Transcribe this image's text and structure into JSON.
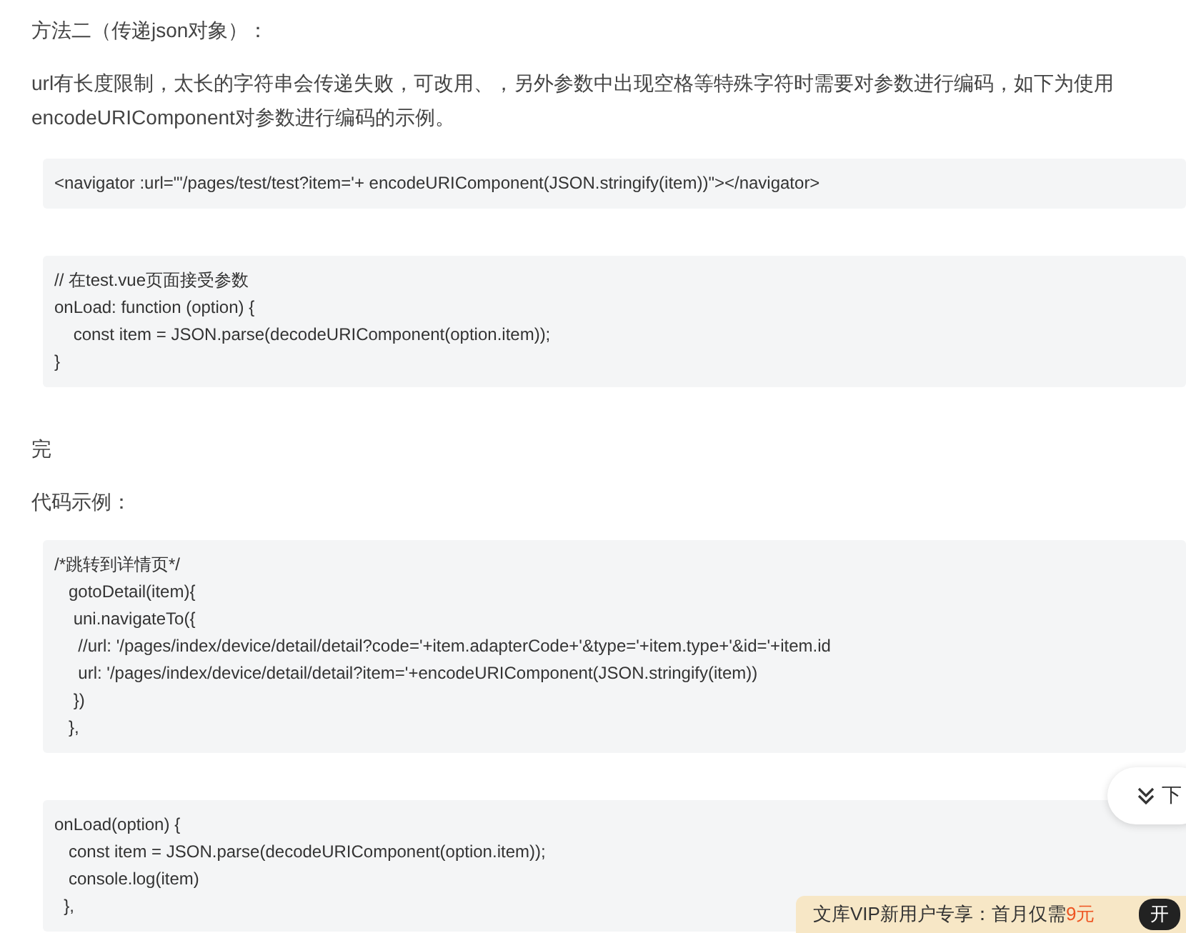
{
  "heading": "方法二（传递json对象）：",
  "paragraph": "url有长度限制，太长的字符串会传递失败，可改用、，另外参数中出现空格等特殊字符时需要对参数进行编码，如下为使用encodeURIComponent对参数进行编码的示例。",
  "code_blocks_1": [
    {
      "lines": [
        "<navigator :url=\"'/pages/test/test?item='+ encodeURIComponent(JSON.stringify(item))\"></navigator>"
      ]
    },
    {
      "lines": [
        "// 在test.vue页面接受参数",
        "onLoad: function (option) {",
        "    const item = JSON.parse(decodeURIComponent(option.item));",
        "}"
      ]
    }
  ],
  "done_text": "完",
  "example_label": "代码示例：",
  "code_blocks_2": [
    {
      "lines": [
        "/*跳转到详情页*/",
        "   gotoDetail(item){",
        "    uni.navigateTo({",
        "     //url: '/pages/index/device/detail/detail?code='+item.adapterCode+'&type='+item.type+'&id='+item.id",
        "     url: '/pages/index/device/detail/detail?item='+encodeURIComponent(JSON.stringify(item))",
        "    })",
        "   },"
      ]
    },
    {
      "lines": [
        "onLoad(option) {",
        "   const item = JSON.parse(decodeURIComponent(option.item));",
        "   console.log(item)",
        "  },"
      ]
    }
  ],
  "next_button": "下",
  "promo_banner": {
    "text": "文库VIP新用户专享：首月仅需",
    "price": "9元",
    "button": "开"
  }
}
